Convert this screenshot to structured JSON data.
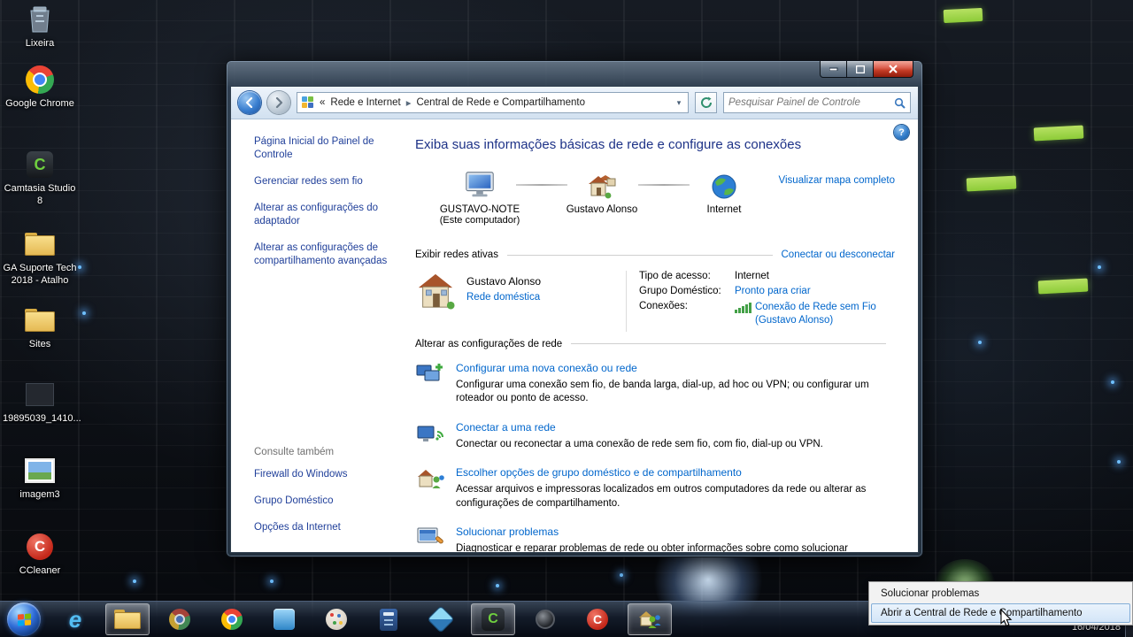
{
  "desktop": {
    "icons": [
      {
        "label": "Lixeira"
      },
      {
        "label": "Google Chrome"
      },
      {
        "label": "Camtasia Studio 8"
      },
      {
        "label": "GA Suporte Tech 2018 - Atalho"
      },
      {
        "label": "Sites"
      },
      {
        "label": "19895039_1410..."
      },
      {
        "label": "imagem3"
      },
      {
        "label": "CCleaner"
      }
    ]
  },
  "window": {
    "nav": {
      "breadcrumb_prefix": "«",
      "breadcrumb_root": "Rede e Internet",
      "breadcrumb_sep": "▸",
      "breadcrumb_current": "Central de Rede e Compartilhamento",
      "dropdown_glyph": "▾",
      "search_placeholder": "Pesquisar Painel de Controle",
      "help_glyph": "?"
    },
    "sidebar": {
      "items": [
        "Página Inicial do Painel de Controle",
        "Gerenciar redes sem fio",
        "Alterar as configurações do adaptador",
        "Alterar as configurações de compartilhamento avançadas"
      ],
      "see_also_header": "Consulte também",
      "see_also_items": [
        "Firewall do Windows",
        "Grupo Doméstico",
        "Opções da Internet"
      ]
    },
    "main": {
      "title": "Exiba suas informações básicas de rede e configure as conexões",
      "map": {
        "computer_name": "GUSTAVO-NOTE",
        "computer_sub": "(Este computador)",
        "network_name": "Gustavo Alonso",
        "internet_name": "Internet",
        "full_map_link": "Visualizar mapa completo"
      },
      "active": {
        "header": "Exibir redes ativas",
        "connect_link": "Conectar ou desconectar",
        "network_name": "Gustavo Alonso",
        "network_type_link": "Rede doméstica",
        "rows": [
          {
            "label": "Tipo de acesso:",
            "value": "Internet"
          },
          {
            "label": "Grupo Doméstico:",
            "value": "Pronto para criar"
          },
          {
            "label": "Conexões:",
            "value": "Conexão de Rede sem Fio (Gustavo Alonso)"
          }
        ]
      },
      "tasks_header": "Alterar as configurações de rede",
      "tasks": [
        {
          "title": "Configurar uma nova conexão ou rede",
          "desc": "Configurar uma conexão sem fio, de banda larga, dial-up, ad hoc ou VPN; ou configurar um roteador ou ponto de acesso."
        },
        {
          "title": "Conectar a uma rede",
          "desc": "Conectar ou reconectar a uma conexão de rede sem fio, com fio, dial-up ou VPN."
        },
        {
          "title": "Escolher opções de grupo doméstico e de compartilhamento",
          "desc": "Acessar arquivos e impressoras localizados em outros computadores da rede ou alterar as configurações de compartilhamento."
        },
        {
          "title": "Solucionar problemas",
          "desc": "Diagnosticar e reparar problemas de rede ou obter informações sobre como solucionar problemas."
        }
      ]
    }
  },
  "context_menu": {
    "items": [
      "Solucionar problemas",
      "Abrir a Central de Rede e Compartilhamento"
    ]
  },
  "taskbar": {
    "date": "16/04/2018",
    "glyphs": {
      "ie": "e",
      "camtasia": "C",
      "ccleaner": "C"
    }
  }
}
